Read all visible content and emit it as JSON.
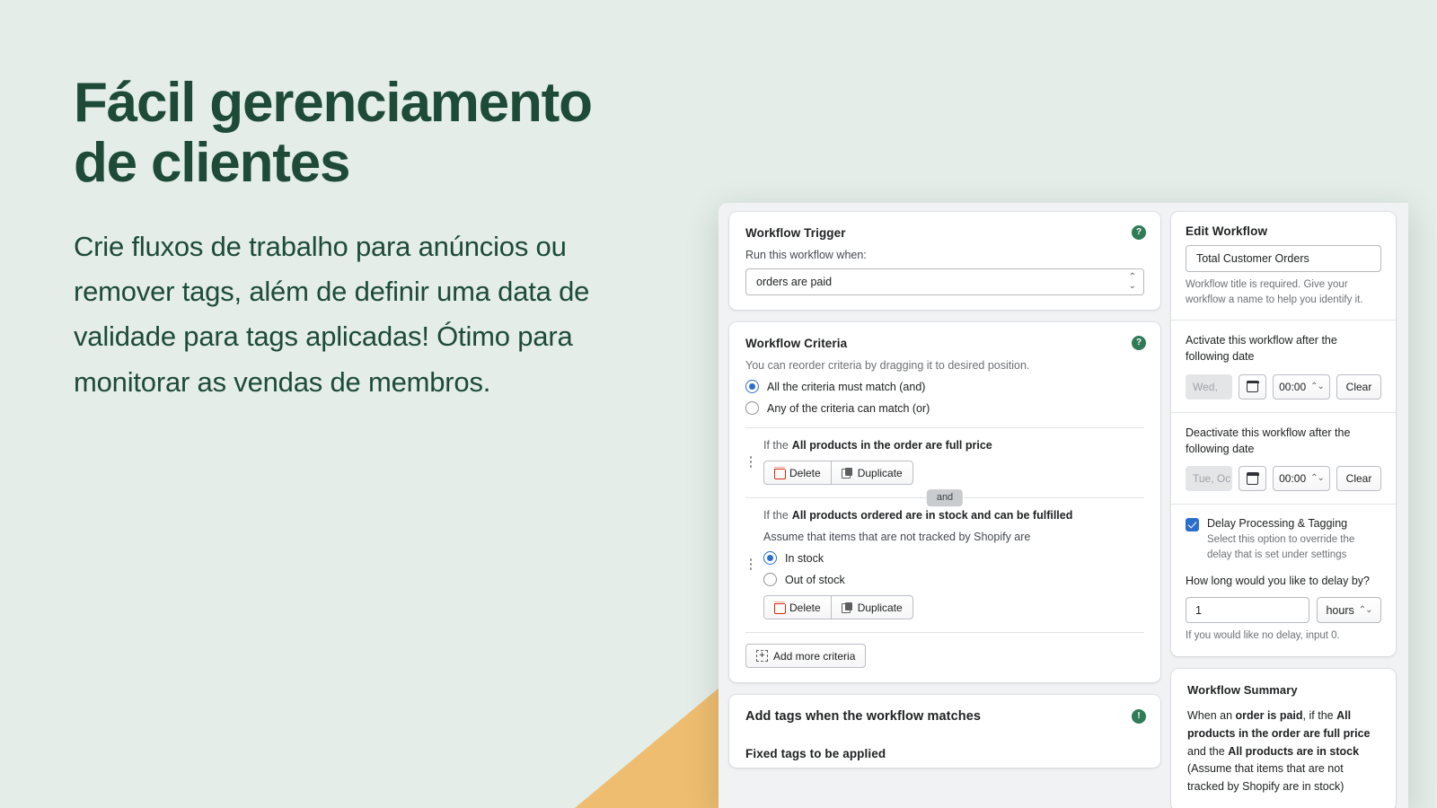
{
  "hero": {
    "title": "Fácil gerenciamento\nde clientes",
    "subtitle": "Crie fluxos de trabalho para anúncios ou remover tags, além de definir uma data de validade para tags aplicadas! Ótimo para monitorar as vendas de membros."
  },
  "colors": {
    "page_bg": "#e4ede8",
    "heading": "#1d4b38",
    "accent_triangle": "#eebd6f",
    "help_badge": "#2f7a57",
    "radio_on": "#2c6ecb",
    "checkbox_on": "#2c6ecb",
    "delete_red": "#d72c0d"
  },
  "app": {
    "trigger_card": {
      "title": "Workflow Trigger",
      "help_icon": "question-mark-icon",
      "label": "Run this workflow when:",
      "select_value": "orders are paid"
    },
    "criteria_card": {
      "title": "Workflow Criteria",
      "help_icon": "question-mark-icon",
      "hint": "You can reorder criteria by dragging it to desired position.",
      "match_options": [
        {
          "label": "All the criteria must match (and)",
          "selected": true
        },
        {
          "label": "Any of the criteria can match (or)",
          "selected": false
        }
      ],
      "criteria": [
        {
          "prefix": "If the",
          "name": "All products in the order are full price",
          "delete_label": "Delete",
          "duplicate_label": "Duplicate"
        },
        {
          "prefix": "If the",
          "name": "All products ordered are in stock and can be fulfilled",
          "assume_label": "Assume that items that are not tracked by Shopify are",
          "stock_options": [
            {
              "label": "In stock",
              "selected": true
            },
            {
              "label": "Out of stock",
              "selected": false
            }
          ],
          "delete_label": "Delete",
          "duplicate_label": "Duplicate"
        }
      ],
      "joiner": "and",
      "add_more_label": "Add more criteria"
    },
    "tags_card": {
      "title": "Add tags when the workflow matches",
      "help_icon": "exclamation-icon",
      "subtitle": "Fixed tags to be applied"
    }
  },
  "side": {
    "edit_card": {
      "title": "Edit Workflow",
      "name_value": "Total Customer Orders",
      "name_help": "Workflow title is required. Give your workflow a name to help you identify it.",
      "activate": {
        "label": "Activate this workflow after the following date",
        "date_placeholder": "Wed, ",
        "time_value": "00:00",
        "clear_label": "Clear",
        "calendar_icon": "calendar-icon"
      },
      "deactivate": {
        "label": "Deactivate this workflow after the following date",
        "date_placeholder": "Tue, Oc",
        "time_value": "00:00",
        "clear_label": "Clear",
        "calendar_icon": "calendar-icon"
      },
      "delay": {
        "checkbox_label": "Delay Processing & Tagging",
        "checkbox_checked": true,
        "checkbox_help": "Select this option to override the delay that is set under settings",
        "question": "How long would you like to delay by?",
        "amount": "1",
        "unit": "hours",
        "hint": "If you would like no delay, input 0."
      }
    },
    "summary_card": {
      "title": "Workflow Summary",
      "parts": [
        {
          "text": "When an ",
          "bold": false
        },
        {
          "text": "order is paid",
          "bold": true
        },
        {
          "text": ", if the ",
          "bold": false
        },
        {
          "text": "All products in the order are full price",
          "bold": true
        },
        {
          "text": " and the ",
          "bold": false
        },
        {
          "text": "All products are in stock",
          "bold": true
        },
        {
          "text": " (Assume that items that are not tracked by Shopify are in stock)",
          "bold": false
        }
      ]
    }
  }
}
